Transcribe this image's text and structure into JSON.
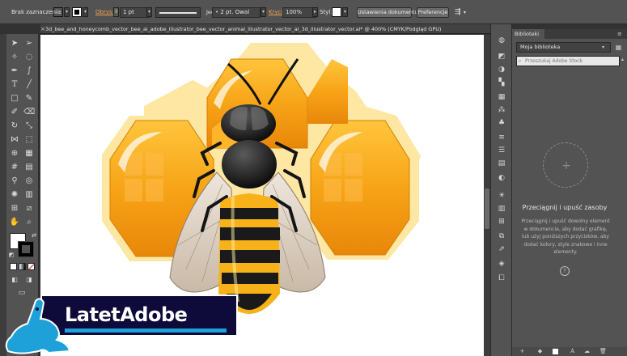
{
  "control_bar": {
    "selection_status": "Brak zaznaczenia",
    "stroke_label": "Obrys:",
    "stroke_weight": "1 pt",
    "stroke_style": "Jednolite",
    "brush": "2 pt. Owal",
    "opacity_label": "Krycie:",
    "opacity_value": "100%",
    "style_label": "Styl:",
    "document_setup_button": "Ustawienia dokumentu",
    "preferences_button": "Preferencje",
    "fill_color": "#ffffff",
    "stroke_color": "#000000"
  },
  "document": {
    "close_glyph": "×",
    "tab_title": "3d_bee_and_honeycomb_vector_bee_ai_adobe_illustrator_bee_vector_animal_illustrator_vector_ai_3d_illustrator_vector.ai* @ 400% (CMYK/Podgląd GPU)"
  },
  "tools": {
    "fill_color": "#ffffff",
    "stroke_color": "#000000"
  },
  "libraries": {
    "tab_label": "Biblioteki",
    "library_name": "Moja biblioteka",
    "search_placeholder": "Przeszukaj Adobe Stock",
    "drop_plus": "+",
    "drop_title": "Przeciągnij i upuść zasoby",
    "drop_desc": "Przeciągnij i upuść dowolny element w dokumencie, aby dodać grafikę, lub użyj poniższych przycisków, aby dodać kolory, style znakowe i inne elementy.",
    "help_glyph": "?"
  },
  "watermark": {
    "text": "LatetAdobe",
    "banner_color": "#0e0a3a",
    "accent_color": "#1da1d8"
  },
  "colors": {
    "honey_orange": "#f5a31a",
    "honey_pale": "#fde7a3",
    "bee_yellow": "#f7b21a",
    "bee_black": "#1a1a1a"
  }
}
